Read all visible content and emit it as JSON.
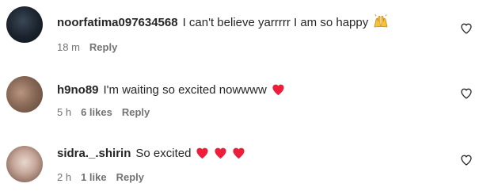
{
  "comments": [
    {
      "username": "noorfatima097634568",
      "text": "I can't believe yarrrrr I am so happy",
      "emoji": "raising-hands",
      "time": "18 m",
      "likes": "",
      "reply_label": "Reply"
    },
    {
      "username": "h9no89",
      "text": "I'm waiting so excited nowwww",
      "emoji": "red-heart",
      "time": "5 h",
      "likes": "6 likes",
      "reply_label": "Reply"
    },
    {
      "username": "sidra._.shirin",
      "text": "So excited",
      "emoji": "red-heart x3",
      "time": "2 h",
      "likes": "1 like",
      "reply_label": "Reply"
    }
  ],
  "colors": {
    "text": "#262626",
    "meta": "#737373",
    "heart": "#ed1e3a"
  }
}
